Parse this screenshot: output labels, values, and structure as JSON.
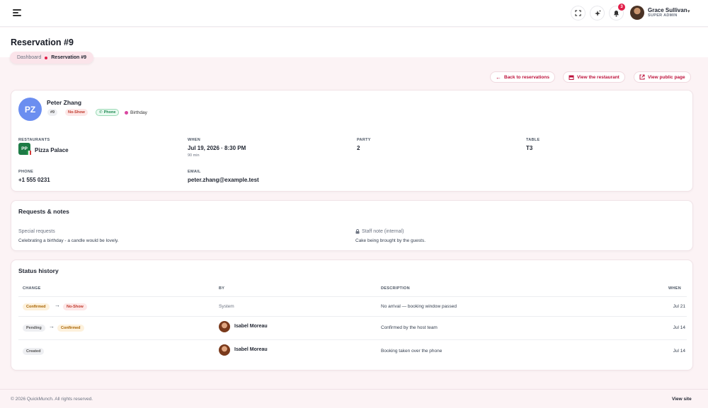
{
  "header": {
    "notifications_count": "3",
    "user": {
      "name": "Grace Sullivan",
      "role": "SUPER ADMIN"
    }
  },
  "page": {
    "title": "Reservation #9",
    "breadcrumb": {
      "root": "Dashboard",
      "current": "Reservation #9"
    }
  },
  "actions": {
    "back": "Back to reservations",
    "view_restaurant": "View the restaurant",
    "view_public": "View public page"
  },
  "guest": {
    "initials": "PZ",
    "name": "Peter Zhang",
    "id_chip": "#9",
    "status_chip": "No-Show",
    "source_chip": "Phone",
    "occasion": "Birthday",
    "accent_color": "#6b8ef0"
  },
  "details": {
    "restaurants_label": "RESTAURANTS",
    "restaurant_logo": "PP",
    "restaurant_name": "Pizza Palace",
    "when_label": "WHEN",
    "when_value": "Jul 19, 2026 · 8:30 PM",
    "duration": "90 min",
    "party_label": "PARTY",
    "party_value": "2",
    "table_label": "TABLE",
    "table_value": "T3",
    "phone_label": "PHONE",
    "phone_value": "+1 555 0231",
    "email_label": "EMAIL",
    "email_value": "peter.zhang@example.test"
  },
  "notes": {
    "title": "Requests & notes",
    "special_label": "Special requests",
    "special_text": "Celebrating a birthday - a candle would be lovely.",
    "staff_label": "Staff note (internal)",
    "staff_text": "Cake being brought by the guests."
  },
  "history": {
    "title": "Status history",
    "columns": {
      "change": "CHANGE",
      "by": "BY",
      "description": "DESCRIPTION",
      "when": "WHEN"
    },
    "rows": [
      {
        "from": "Confirmed",
        "to": "No-Show",
        "by": "System",
        "description": "No arrival — booking window passed",
        "when": "Jul 21"
      },
      {
        "from": "Pending",
        "to": "Confirmed",
        "by": "Isabel Moreau",
        "description": "Confirmed by the host team",
        "when": "Jul 14"
      },
      {
        "from": "Created",
        "by": "Isabel Moreau",
        "description": "Booking taken over the phone",
        "when": "Jul 14"
      }
    ]
  },
  "footer": {
    "copyright": "© 2026 QuickMunch. All rights reserved.",
    "link": "View site"
  }
}
